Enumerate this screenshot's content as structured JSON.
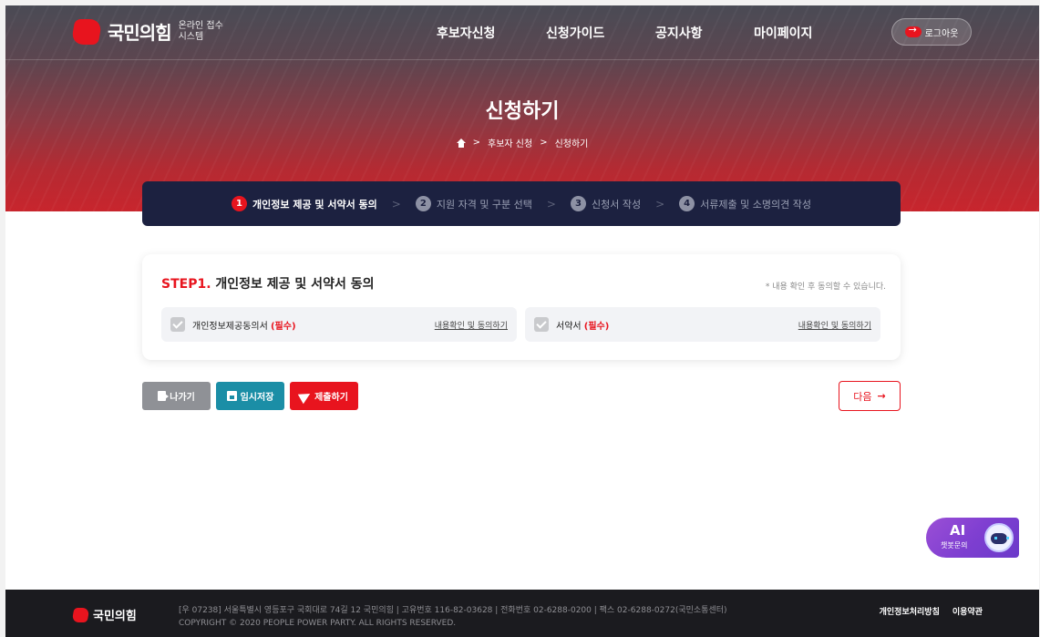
{
  "header": {
    "logo_text": "국민의힘",
    "logo_sub_line1": "온라인 접수",
    "logo_sub_line2": "시스템",
    "nav": [
      "후보자신청",
      "신청가이드",
      "공지사항",
      "마이페이지"
    ],
    "logout_label": "로그아웃"
  },
  "hero": {
    "title": "신청하기",
    "breadcrumb": [
      "후보자 신청",
      "신청하기"
    ]
  },
  "steps": [
    {
      "num": "1",
      "label": "개인정보 제공 및 서약서 동의",
      "active": true
    },
    {
      "num": "2",
      "label": "지원 자격 및 구분 선택",
      "active": false
    },
    {
      "num": "3",
      "label": "신청서 작성",
      "active": false
    },
    {
      "num": "4",
      "label": "서류제출 및 소명의견 작성",
      "active": false
    }
  ],
  "card": {
    "step_label": "STEP1.",
    "title": " 개인정보 제공 및 서약서 동의",
    "note": "* 내용 확인 후 동의할 수 있습니다.",
    "agreements": [
      {
        "label": "개인정보제공동의서 ",
        "required": "(필수)",
        "link": "내용확인 및 동의하기"
      },
      {
        "label": "서약서 ",
        "required": "(필수)",
        "link": "내용확인 및 동의하기"
      }
    ]
  },
  "actions": {
    "exit": "나가기",
    "save": "임시저장",
    "submit": "제출하기",
    "next": "다음",
    "next_arrow": "→"
  },
  "ai_chat": {
    "title": "AI",
    "subtitle": "챗봇문의"
  },
  "footer": {
    "logo_text": "국민의힘",
    "address_line": "[우 07238] 서울특별시 영등포구 국회대로 74길 12 국민의힘  |  고유번호 116-82-03628  |  전화번호 02-6288-0200  |  팩스 02-6288-0272(국민소통센터)",
    "copyright": "COPYRIGHT © 2020 PEOPLE POWER PARTY. ALL RIGHTS RESERVED.",
    "links": [
      "개인정보처리방침",
      "이용약관"
    ]
  },
  "colors": {
    "brand_red": "#e8141e",
    "step_bar": "#1c2140",
    "save_teal": "#1b8ea6",
    "exit_gray": "#8f9196",
    "footer_bg": "#1b1b1f"
  }
}
